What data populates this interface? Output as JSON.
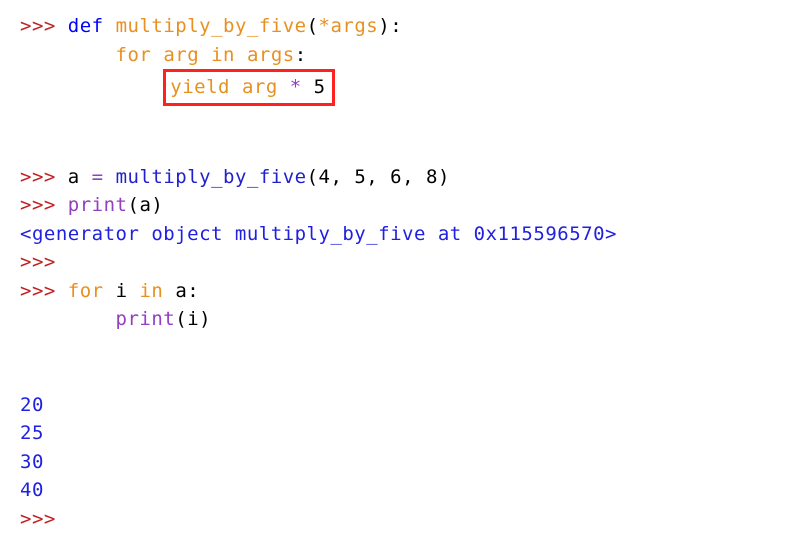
{
  "code": {
    "prompt": ">>>",
    "cont": "...",
    "kw_def": "def",
    "kw_for": "for",
    "kw_in": "in",
    "kw_yield": "yield",
    "func_name": "multiply_by_five",
    "star_args": "*args",
    "colon": ":",
    "var_arg": "arg",
    "var_args": "args",
    "mult_op": "*",
    "five": "5",
    "var_a": "a",
    "assign": " = ",
    "call_args": "4, 5, 6, 8",
    "print_name": "print",
    "print_param_a": "a",
    "var_i": "i",
    "print_param_i": "i",
    "lparen": "(",
    "rparen": ")"
  },
  "output": {
    "generator_repr": "<generator object multiply_by_five at 0x115596570>",
    "values": [
      "20",
      "25",
      "30",
      "40"
    ]
  }
}
